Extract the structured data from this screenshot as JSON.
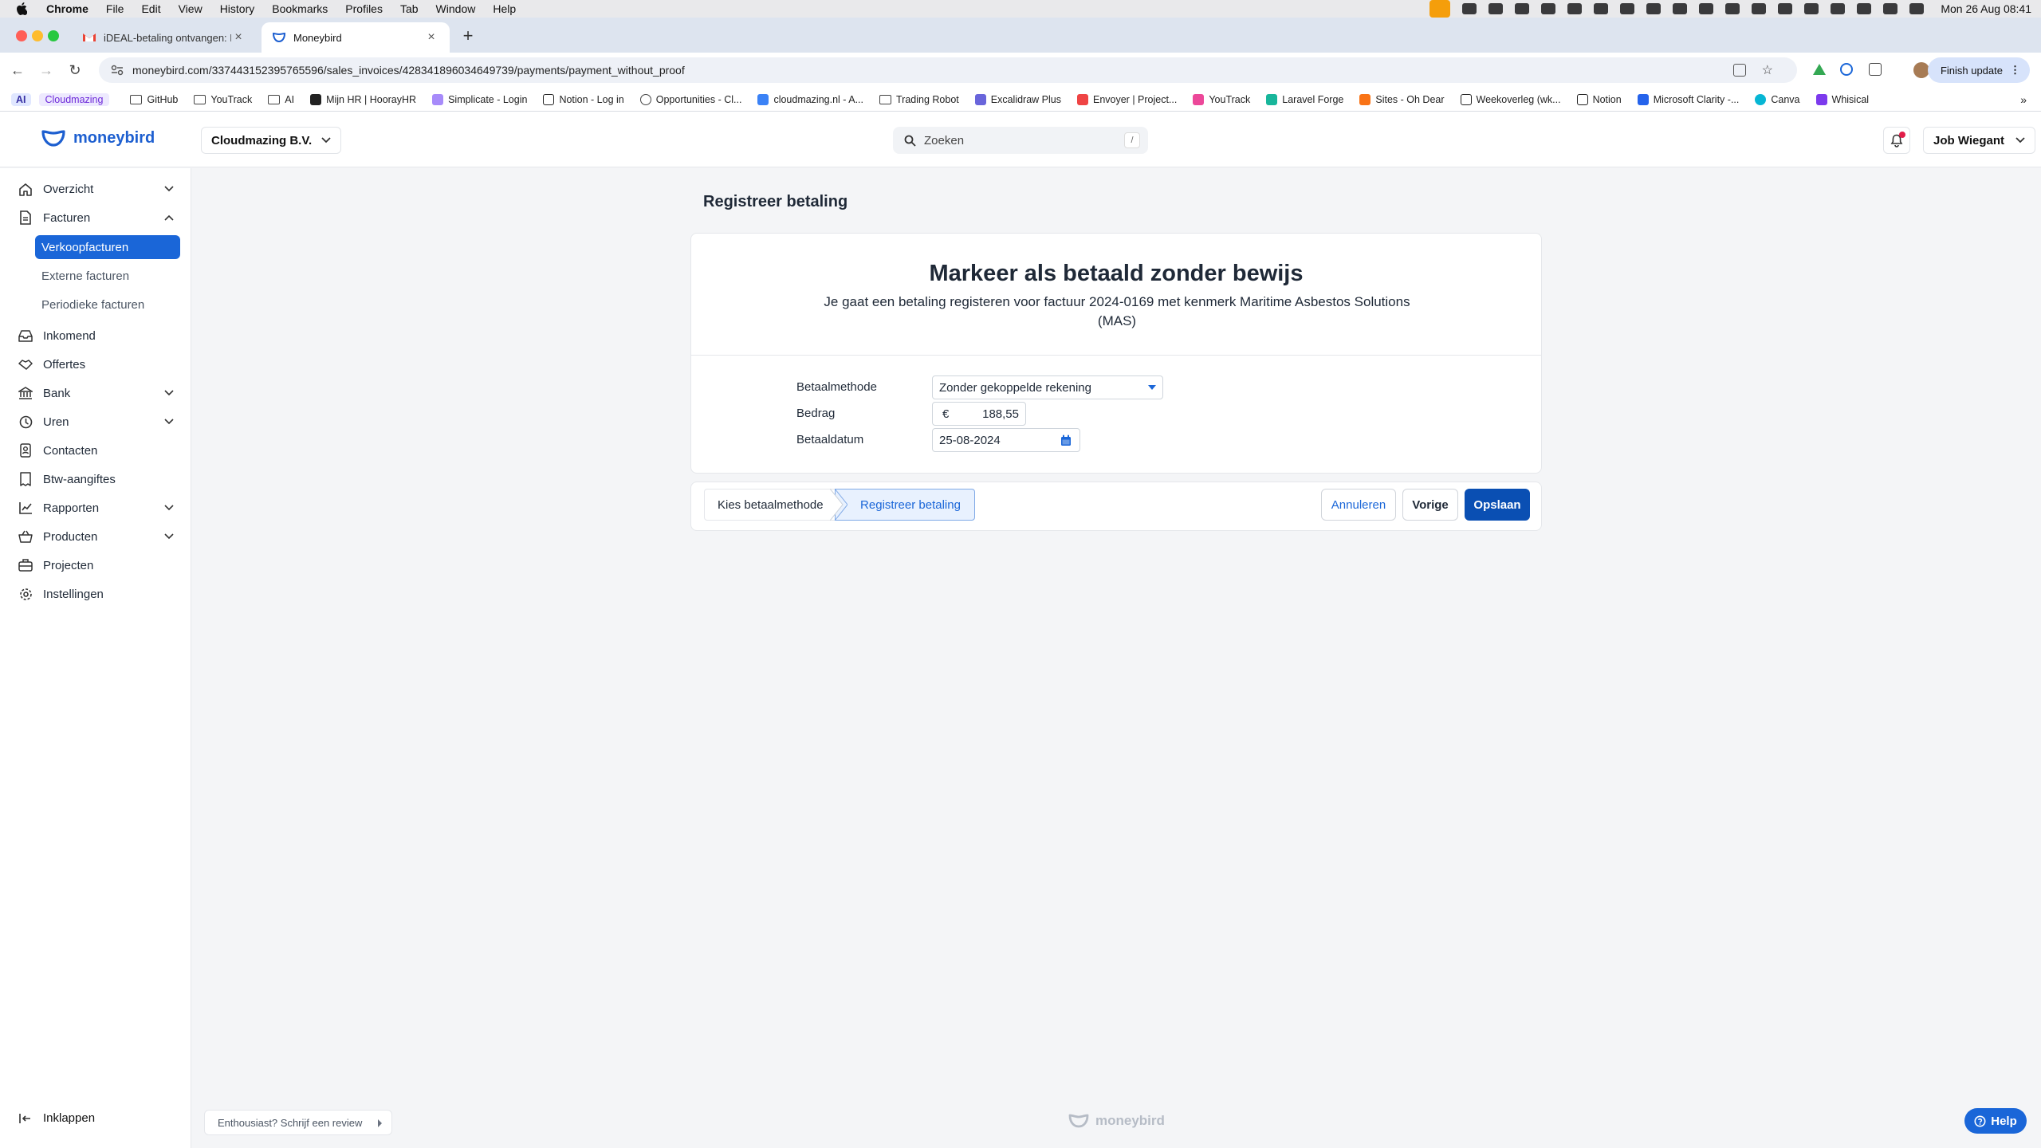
{
  "menubar": {
    "app": "Chrome",
    "items": [
      "File",
      "Edit",
      "View",
      "History",
      "Bookmarks",
      "Profiles",
      "Tab",
      "Window",
      "Help"
    ],
    "clock": "Mon 26 Aug  08:41"
  },
  "browser": {
    "tabs": [
      {
        "title": "iDEAL-betaling ontvangen: Fa"
      },
      {
        "title": "Moneybird"
      }
    ],
    "url": "moneybird.com/337443152395765596/sales_invoices/428341896034649739/payments/payment_without_proof",
    "finish_update": "Finish update",
    "bookmarks": [
      "AI",
      "Cloudmazing",
      "GitHub",
      "YouTrack",
      "AI",
      "Mijn HR | HoorayHR",
      "Simplicate - Login",
      "Notion - Log in",
      "Opportunities - Cl...",
      "cloudmazing.nl - A...",
      "Trading Robot",
      "Excalidraw Plus",
      "Envoyer | Project...",
      "YouTrack",
      "Laravel Forge",
      "Sites - Oh Dear",
      "Weekoverleg (wk...",
      "Notion",
      "Microsoft Clarity -...",
      "Canva",
      "Whisical"
    ]
  },
  "header": {
    "logo": "moneybird",
    "company": "Cloudmazing B.V.",
    "search_placeholder": "Zoeken",
    "search_shortcut": "/",
    "user": "Job Wiegant"
  },
  "sidebar": {
    "items": [
      {
        "label": "Overzicht"
      },
      {
        "label": "Facturen"
      },
      {
        "label": "Inkomend"
      },
      {
        "label": "Offertes"
      },
      {
        "label": "Bank"
      },
      {
        "label": "Uren"
      },
      {
        "label": "Contacten"
      },
      {
        "label": "Btw-aangiftes"
      },
      {
        "label": "Rapporten"
      },
      {
        "label": "Producten"
      },
      {
        "label": "Projecten"
      },
      {
        "label": "Instellingen"
      }
    ],
    "subitems": [
      {
        "label": "Verkoopfacturen"
      },
      {
        "label": "Externe facturen"
      },
      {
        "label": "Periodieke facturen"
      }
    ],
    "collapse": "Inklappen"
  },
  "main": {
    "page_title": "Registreer betaling",
    "card_title": "Markeer als betaald zonder bewijs",
    "card_description": "Je gaat een betaling registeren voor factuur 2024-0169 met kenmerk Maritime Asbestos Solutions (MAS)",
    "form": {
      "method_label": "Betaalmethode",
      "method_value": "Zonder gekoppelde rekening",
      "amount_label": "Bedrag",
      "currency": "€",
      "amount_value": "188,55",
      "date_label": "Betaaldatum",
      "date_value": "25-08-2024"
    },
    "steps": [
      "Kies betaalmethode",
      "Registreer betaling"
    ],
    "buttons": {
      "cancel": "Annuleren",
      "previous": "Vorige",
      "save": "Opslaan"
    }
  },
  "footer": {
    "review": "Enthousiast? Schrijf een review",
    "logo": "moneybird",
    "help": "Help"
  },
  "colors": {
    "accent": "#1a66d8",
    "primary_button": "#0a4fb3",
    "notification": "#e11d48"
  }
}
